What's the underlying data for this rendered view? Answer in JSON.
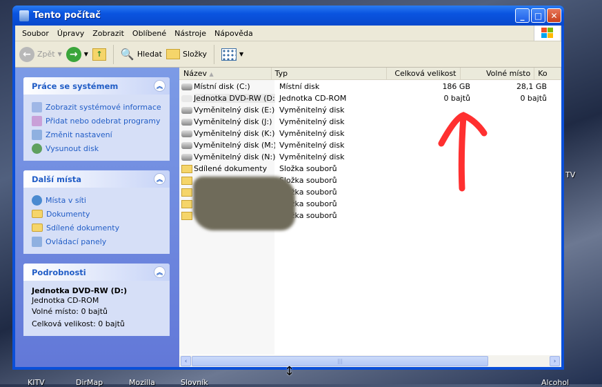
{
  "window": {
    "title": "Tento počítač"
  },
  "menu": [
    "Soubor",
    "Úpravy",
    "Zobrazit",
    "Oblíbené",
    "Nástroje",
    "Nápověda"
  ],
  "toolbar": {
    "back": "Zpět",
    "search": "Hledat",
    "folders": "Složky"
  },
  "left_panel": {
    "system_tasks": {
      "title": "Práce se systémem",
      "items": [
        "Zobrazit systémové informace",
        "Přidat nebo odebrat programy",
        "Změnit nastavení",
        "Vysunout disk"
      ]
    },
    "other_places": {
      "title": "Další místa",
      "items": [
        "Místa v síti",
        "Dokumenty",
        "Sdílené dokumenty",
        "Ovládací panely"
      ]
    },
    "details": {
      "title": "Podrobnosti",
      "name": "Jednotka DVD-RW (D:)",
      "type": "Jednotka CD-ROM",
      "free": "Volné místo: 0 bajtů",
      "total": "Celková velikost: 0 bajtů"
    }
  },
  "columns": [
    "Název",
    "Typ",
    "Celková velikost",
    "Volné místo",
    "Ko"
  ],
  "rows": [
    {
      "name": "Místní disk (C:)",
      "type": "Místní disk",
      "total": "186 GB",
      "free": "28,1 GB",
      "icon": "hard-disk"
    },
    {
      "name": "Jednotka DVD-RW (D:)",
      "type": "Jednotka CD-ROM",
      "total": "0 bajtů",
      "free": "0 bajtů",
      "icon": "dvd-drive"
    },
    {
      "name": "Vyměnitelný disk (E:)",
      "type": "Vyměnitelný disk",
      "total": "",
      "free": "",
      "icon": "removable-disk"
    },
    {
      "name": "Vyměnitelný disk (J:)",
      "type": "Vyměnitelný disk",
      "total": "",
      "free": "",
      "icon": "removable-disk"
    },
    {
      "name": "Vyměnitelný disk (K:)",
      "type": "Vyměnitelný disk",
      "total": "",
      "free": "",
      "icon": "removable-disk"
    },
    {
      "name": "Vyměnitelný disk (M:)",
      "type": "Vyměnitelný disk",
      "total": "",
      "free": "",
      "icon": "removable-disk"
    },
    {
      "name": "Vyměnitelný disk (N:)",
      "type": "Vyměnitelný disk",
      "total": "",
      "free": "",
      "icon": "removable-disk"
    },
    {
      "name": "Sdílené dokumenty",
      "type": "Složka souborů",
      "total": "",
      "free": "",
      "icon": "folder"
    },
    {
      "name": "",
      "type": "Složka souborů",
      "total": "",
      "free": "",
      "icon": "folder"
    },
    {
      "name": "",
      "type": "Složka souborů",
      "total": "",
      "free": "",
      "icon": "folder"
    },
    {
      "name": "",
      "type": "Složka souborů",
      "total": "",
      "free": "",
      "icon": "folder"
    },
    {
      "name": "",
      "type": "Složka souborů",
      "total": "",
      "free": "",
      "icon": "folder"
    }
  ],
  "desktop": {
    "labels": [
      "KITV",
      "DirMap",
      "Mozilla",
      "Slovník",
      "Alcohol",
      "TV"
    ]
  },
  "colors": {
    "title_bar": "#0a54e0",
    "task_pane": "#6278d8",
    "annotation_arrow": "#ff1a1a"
  }
}
